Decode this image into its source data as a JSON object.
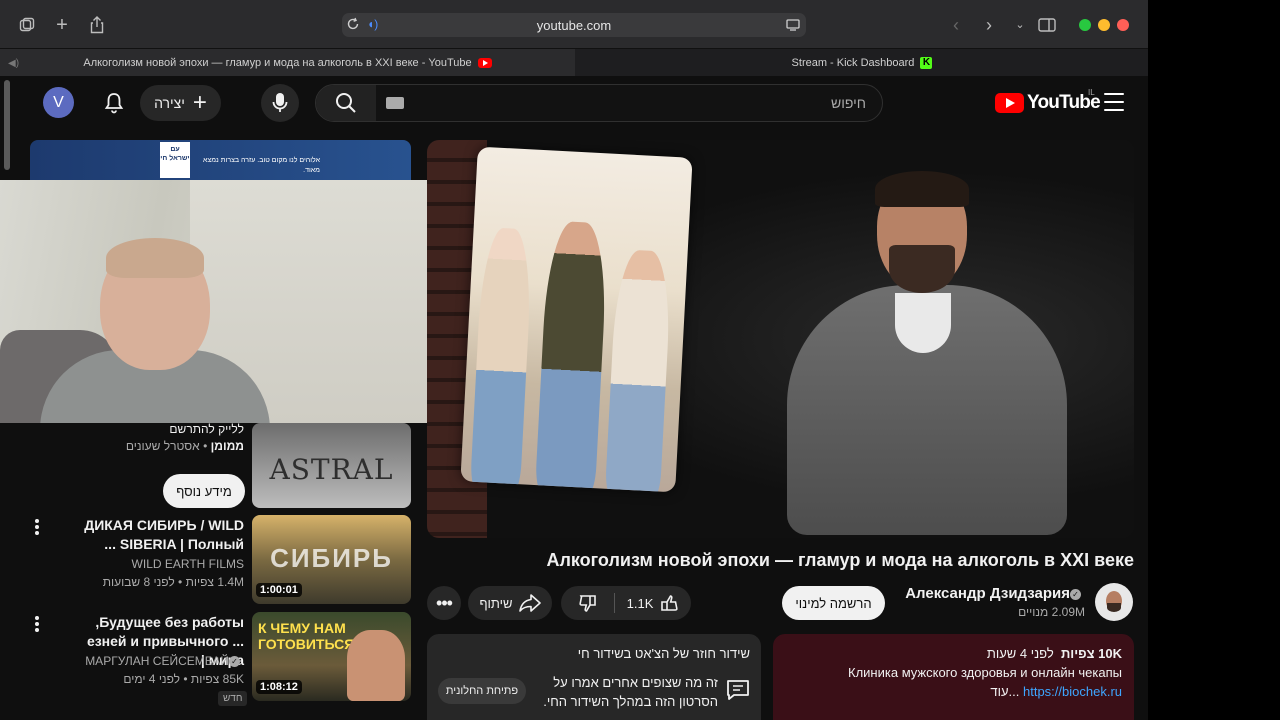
{
  "browser": {
    "url": "youtube.com",
    "tabs": [
      {
        "title": "Алкоголизм новой эпохи — гламур и мода на алкоголь в XXI веке - YouTube",
        "active": true
      },
      {
        "title": "Stream - Kick Dashboard",
        "active": false
      }
    ],
    "traffic_colors": [
      "#28c840",
      "#febc2e",
      "#ff5f57"
    ]
  },
  "masthead": {
    "avatar_letter": "V",
    "create_label": "יצירה",
    "search_placeholder": "חיפוש",
    "logo_text": "YouTube",
    "logo_sup": "IL"
  },
  "ad": {
    "flag_text": "עם ישראל חי",
    "text": "אלוהים לנו מקום טוב. עזרה בצרות נמצא מאוד."
  },
  "sidebar": {
    "promo": {
      "title": "ללייק להתרשם",
      "meta_channel": "ממומן",
      "meta_sep": "•",
      "meta_desc": "אסטרל שעונים",
      "thumb_text": "ASTRAL",
      "more_info_label": "מידע נוסף"
    },
    "items": [
      {
        "title_line1": "ДИКАЯ СИБИРЬ / WILD",
        "title_line2": "SIBERIA | Полный ...",
        "channel": "WILD EARTH FILMS",
        "meta": "1.4M צפיות • לפני 8 שבועות",
        "thumb_text": "СИБИРЬ",
        "duration": "1:00:01"
      },
      {
        "title_line1": "Будущее без работы,",
        "title_line2": "... езней и привычного мира |",
        "channel": "МАРГУЛАН СЕЙСЕМБАЙ",
        "meta": "85K צפיות • לפני 4 ימים",
        "badge": "חדש",
        "thumb_text": "К ЧЕМУ НАМ ГОТОВИТЬСЯ?",
        "duration": "1:08:12"
      }
    ]
  },
  "video": {
    "title": "Алкоголизм новой эпохи — гламур и мода на алкоголь в XXI веке",
    "channel_name": "Александр Дзидзария",
    "subscribers": "2.09M מנויים",
    "subscribe_label": "הרשמה למינוי",
    "likes": "1.1K",
    "share_label": "שיתוף"
  },
  "chat": {
    "title": "שידור חוזר של הצ'אט בשידור חי",
    "description": "זה מה שצופים אחרים אמרו על הסרטון הזה במהלך השידור החי.",
    "open_label": "פתיחת החלונית"
  },
  "description": {
    "views": "10K צפיות",
    "age": "לפני 4 שעות",
    "line2": "Клиника мужского здоровья и онлайн чекапы",
    "link": "https://biochek.ru",
    "more_label": "...עוד"
  }
}
